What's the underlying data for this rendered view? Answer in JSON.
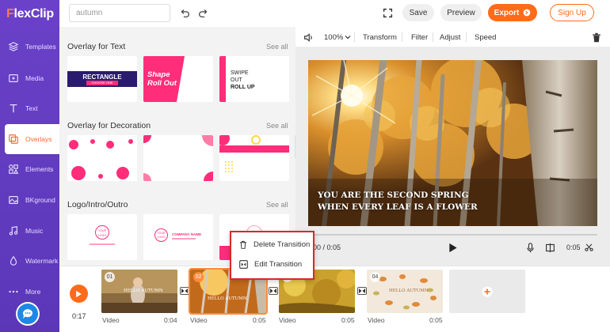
{
  "app": {
    "logo_part1": "F",
    "logo_part2": "lexClip"
  },
  "sidebar": {
    "items": [
      {
        "label": "Templates",
        "icon": "layers-icon"
      },
      {
        "label": "Media",
        "icon": "media-icon"
      },
      {
        "label": "Text",
        "icon": "text-icon"
      },
      {
        "label": "Overlays",
        "icon": "overlays-icon",
        "active": true
      },
      {
        "label": "Elements",
        "icon": "elements-icon"
      },
      {
        "label": "BKground",
        "icon": "background-icon"
      },
      {
        "label": "Music",
        "icon": "music-icon"
      },
      {
        "label": "Watermark",
        "icon": "watermark-icon"
      },
      {
        "label": "More",
        "icon": "more-icon"
      }
    ]
  },
  "header": {
    "search_placeholder": "autumn",
    "save_label": "Save",
    "preview_label": "Preview",
    "export_label": "Export",
    "signup_label": "Sign Up"
  },
  "panel": {
    "sections": [
      {
        "title": "Overlay for Text",
        "see_all": "See all"
      },
      {
        "title": "Overlay for Decoration",
        "see_all": "See all"
      },
      {
        "title": "Logo/Intro/Outro",
        "see_all": "See all"
      }
    ],
    "text_cards": {
      "card1_line1": "RECTANGLE",
      "card1_line2": "CHOOSE ONE",
      "card2_line1": "Shape",
      "card2_line2": "Roll Out",
      "card3_line1": "SWIPE",
      "card3_line2": "OUT",
      "card3_line3": "ROLL UP"
    },
    "logo_cards": {
      "card1_logo": "YOUR LOGO",
      "card2_logo": "YOUR LOGO",
      "card2_company": "COMPANY NAME"
    }
  },
  "preview_toolbar": {
    "zoom": "100%",
    "transform": "Transform",
    "filter": "Filter",
    "adjust": "Adjust",
    "speed": "Speed"
  },
  "preview": {
    "caption_line1": "YOU ARE THE SECOND SPRING",
    "caption_line2": "WHEN EVERY LEAF IS A FLOWER",
    "time_current": "00 / 0:05",
    "time_total": "0:05"
  },
  "context_menu": {
    "delete": "Delete Transition",
    "edit": "Edit Transition"
  },
  "timeline": {
    "total_time": "0:17",
    "clips": [
      {
        "num": "01",
        "type": "Video",
        "duration": "0:04",
        "overlay": "HELLO AUTUMN"
      },
      {
        "num": "02",
        "type": "Video",
        "duration": "0:05",
        "overlay": "HELLO AUTUMN"
      },
      {
        "num": "03",
        "type": "Video",
        "duration": "0:05"
      },
      {
        "num": "04",
        "type": "Video",
        "duration": "0:05",
        "overlay": "HELLO AUTUMN"
      }
    ]
  },
  "colors": {
    "accent": "#ff6b1a",
    "sidebar": "#5e3bbf",
    "highlight_red": "#d62a2a",
    "pink": "#ff2d7a"
  }
}
